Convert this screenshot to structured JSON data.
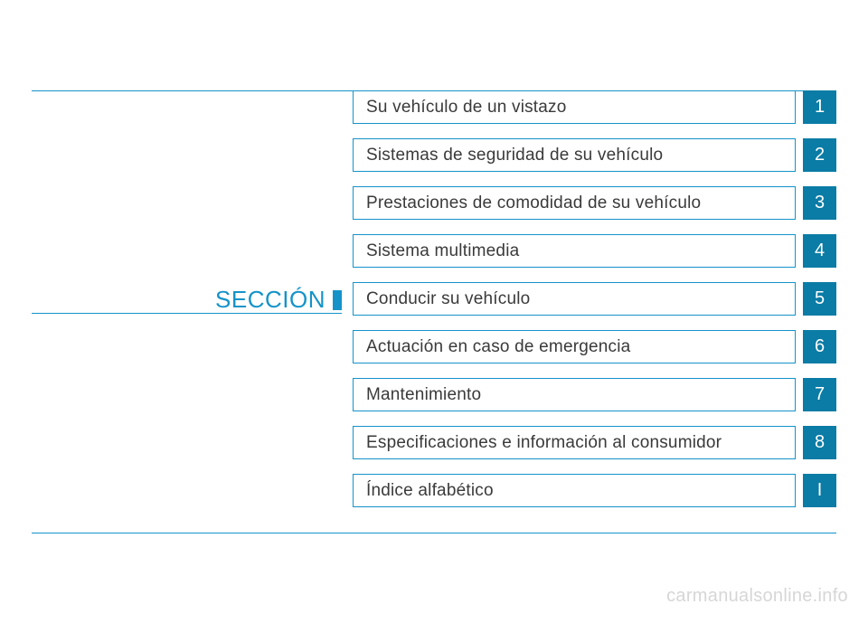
{
  "sectionLabel": "SECCIÓN",
  "toc": [
    {
      "label": "Su vehículo de un vistazo",
      "num": "1"
    },
    {
      "label": "Sistemas de seguridad de su vehículo",
      "num": "2"
    },
    {
      "label": "Prestaciones de comodidad de su vehículo",
      "num": "3"
    },
    {
      "label": "Sistema multimedia",
      "num": "4"
    },
    {
      "label": "Conducir su vehículo",
      "num": "5"
    },
    {
      "label": "Actuación en caso de emergencia",
      "num": "6"
    },
    {
      "label": "Mantenimiento",
      "num": "7"
    },
    {
      "label": "Especificaciones e información al consumidor",
      "num": "8"
    },
    {
      "label": "Índice alfabético",
      "num": "I"
    }
  ],
  "watermark": "carmanualsonline.info"
}
